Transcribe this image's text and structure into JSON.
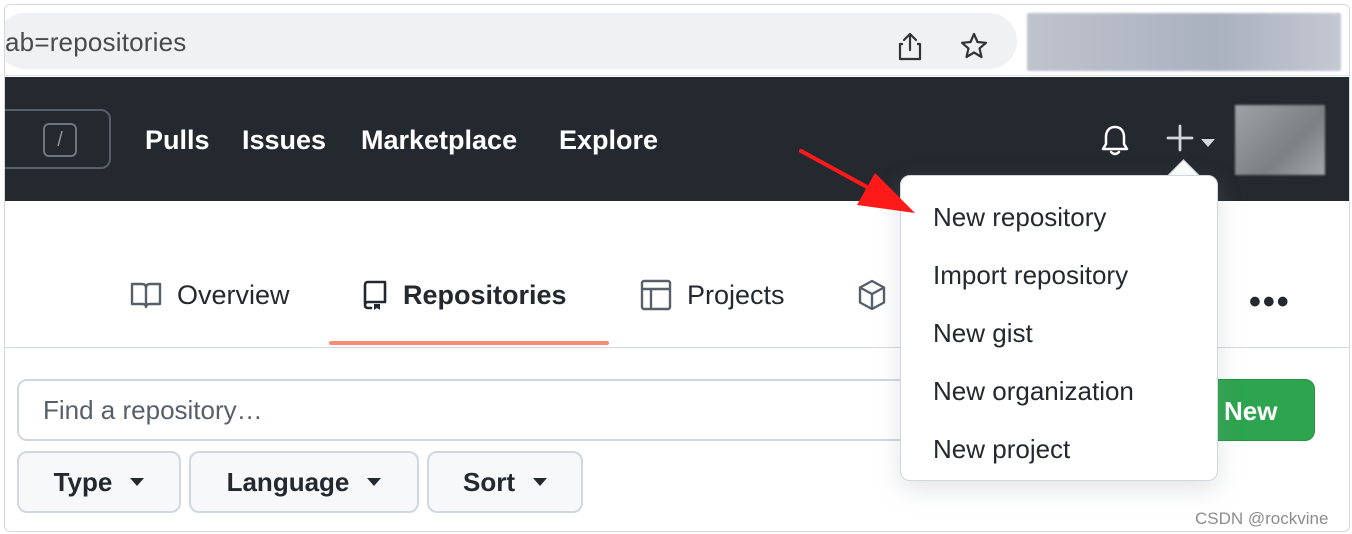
{
  "browser": {
    "url_fragment": "ab=repositories",
    "share_icon": "share-icon",
    "bookmark_icon": "star-icon"
  },
  "header": {
    "search_shortcut": "/",
    "nav": [
      "Pulls",
      "Issues",
      "Marketplace",
      "Explore"
    ],
    "bell_icon": "bell-icon",
    "plus_icon": "plus-icon"
  },
  "tabs": [
    {
      "label": "Overview",
      "icon": "book-icon"
    },
    {
      "label": "Repositories",
      "icon": "repo-icon",
      "active": true
    },
    {
      "label": "Projects",
      "icon": "table-icon"
    },
    {
      "label": "",
      "icon": "package-icon"
    }
  ],
  "more": "•••",
  "repo_search": {
    "placeholder": "Find a repository…"
  },
  "new_button": "New",
  "filters": [
    "Type",
    "Language",
    "Sort"
  ],
  "dropdown": {
    "items": [
      "New repository",
      "Import repository",
      "New gist",
      "New organization",
      "New project"
    ]
  },
  "annotation": {
    "arrow_color": "#ff0000"
  },
  "watermark": "CSDN @rockvine",
  "colors": {
    "header_bg": "#24292f",
    "accent_tab": "#fd8c73",
    "primary_green": "#2da44e"
  }
}
